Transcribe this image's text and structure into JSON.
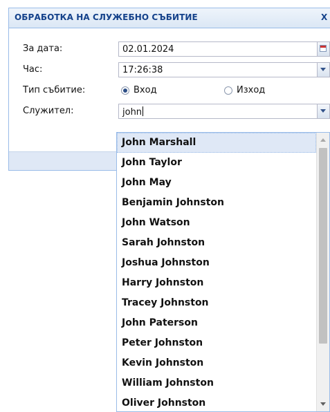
{
  "panel": {
    "title": "ОБРАБОТКА НА СЛУЖЕБНО СЪБИТИЕ",
    "close_label": "X"
  },
  "form": {
    "date_label": "За дата:",
    "date_value": "02.01.2024",
    "time_label": "Час:",
    "time_value": "17:26:38",
    "event_type_label": "Тип събитие:",
    "event_options": [
      {
        "label": "Вход",
        "checked": true
      },
      {
        "label": "Изход",
        "checked": false
      }
    ],
    "employee_label": "Служител:",
    "employee_value": "john"
  },
  "dropdown": {
    "selected_index": 0,
    "items": [
      "John Marshall",
      "John Taylor",
      "John May",
      "Benjamin Johnston",
      "John Watson",
      "Sarah Johnston",
      "Joshua Johnston",
      "Harry Johnston",
      "Tracey Johnston",
      "John Paterson",
      "Peter Johnston",
      "Kevin Johnston",
      "William Johnston",
      "Oliver Johnston"
    ]
  },
  "icons": {
    "close": "close-icon",
    "calendar": "calendar-icon",
    "dropdown": "chevron-down-icon"
  }
}
